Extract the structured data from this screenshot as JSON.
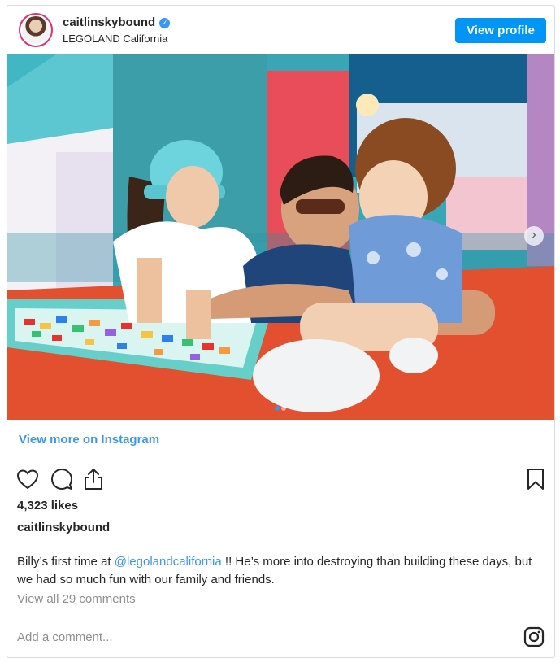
{
  "header": {
    "username": "caitlinskybound",
    "location": "LEGOLAND California",
    "view_profile_label": "View profile"
  },
  "media": {
    "carousel_count": 2,
    "active_index": 1
  },
  "view_more_label": "View more on Instagram",
  "likes": "4,323 likes",
  "caption": {
    "username": "caitlinskybound",
    "text_before": "Billy’s first time at ",
    "mention": "@legolandcalifornia",
    "text_after": " !! He’s more into destroying than building these days, but we had so much fun with our family and friends."
  },
  "comments_link": "View all 29 comments",
  "add_comment_placeholder": "Add a comment...",
  "icons": {
    "like": "heart-icon",
    "comment": "comment-icon",
    "share": "share-icon",
    "save": "bookmark-icon",
    "instagram": "instagram-icon",
    "verified": "verified-badge-icon",
    "next": "chevron-right-icon"
  },
  "colors": {
    "accent": "#0095f6",
    "link": "#3897f0",
    "muted": "#8e8e8e",
    "border": "#dbdbdb"
  }
}
